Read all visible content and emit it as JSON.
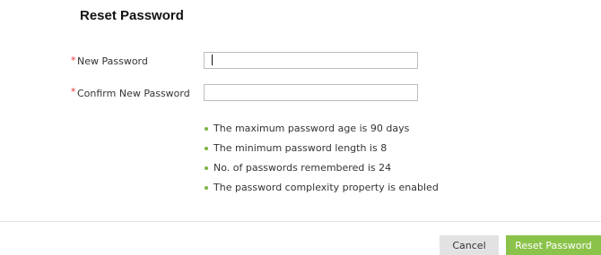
{
  "dialog": {
    "title": "Reset Password"
  },
  "form": {
    "required_marker": "*",
    "new_password": {
      "label": "New Password",
      "value": ""
    },
    "confirm_password": {
      "label": "Confirm New Password",
      "value": ""
    }
  },
  "policy": {
    "rules": [
      "The maximum password age is 90 days",
      "The minimum password length is 8",
      "No. of passwords remembered is 24",
      "The password complexity property is enabled"
    ]
  },
  "footer": {
    "cancel_label": "Cancel",
    "reset_label": "Reset Password"
  },
  "colors": {
    "required": "#e53935",
    "accent": "#8bc34a",
    "bullet": "#7cb342"
  }
}
